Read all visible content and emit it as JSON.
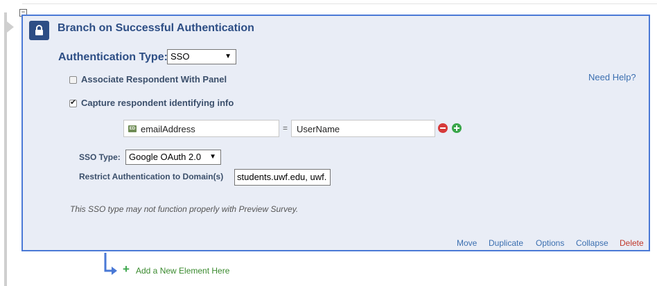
{
  "element": {
    "title": "Branch on Successful Authentication",
    "collapse_toggle": "−",
    "icon": "lock-icon"
  },
  "auth": {
    "type_label": "Authentication Type:",
    "type_value": "SSO",
    "need_help": "Need Help?"
  },
  "options": {
    "associate_panel": {
      "label": "Associate Respondent With Panel",
      "checked": false
    },
    "capture_info": {
      "label": "Capture respondent identifying info",
      "checked": true
    }
  },
  "mapping": {
    "tag": "ED",
    "embedded_field": "emailAddress",
    "equals": "=",
    "value": "UserName"
  },
  "sso": {
    "type_label": "SSO Type:",
    "type_value": "Google OAuth 2.0",
    "domain_label": "Restrict Authentication to Domain(s)",
    "domain_value": "students.uwf.edu, uwf."
  },
  "note": "This SSO type may not function properly with Preview Survey.",
  "footer": {
    "move": "Move",
    "duplicate": "Duplicate",
    "options": "Options",
    "collapse": "Collapse",
    "delete": "Delete"
  },
  "add_element": "Add a New Element Here",
  "colors": {
    "accent": "#4a79d6",
    "heading": "#2d4e85",
    "panel_bg": "#e9edf6",
    "link": "#3b6fb0",
    "delete": "#c0392b",
    "add": "#3aa64a"
  }
}
